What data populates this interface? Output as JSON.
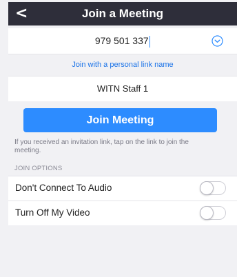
{
  "nav": {
    "back_icon": "chevron-left-icon",
    "back_glyph": "<",
    "title": "Join a Meeting"
  },
  "meeting_id": {
    "value": "979 501 337",
    "dropdown_icon": "chevron-down-circle-icon"
  },
  "personal_link": {
    "label": "Join with a personal link name"
  },
  "display_name": {
    "value": "WITN Staff 1"
  },
  "join_button": {
    "label": "Join Meeting"
  },
  "hint": {
    "text": "If you received an invitation link, tap on the link to join the meeting."
  },
  "join_options": {
    "header": "JOIN OPTIONS",
    "items": [
      {
        "label": "Don't Connect To Audio",
        "enabled": false
      },
      {
        "label": "Turn Off My Video",
        "enabled": false
      }
    ]
  },
  "colors": {
    "nav_bg": "#2e2e3a",
    "accent": "#2d8cff",
    "link": "#1a73e8",
    "page_bg": "#f1f1f4"
  }
}
